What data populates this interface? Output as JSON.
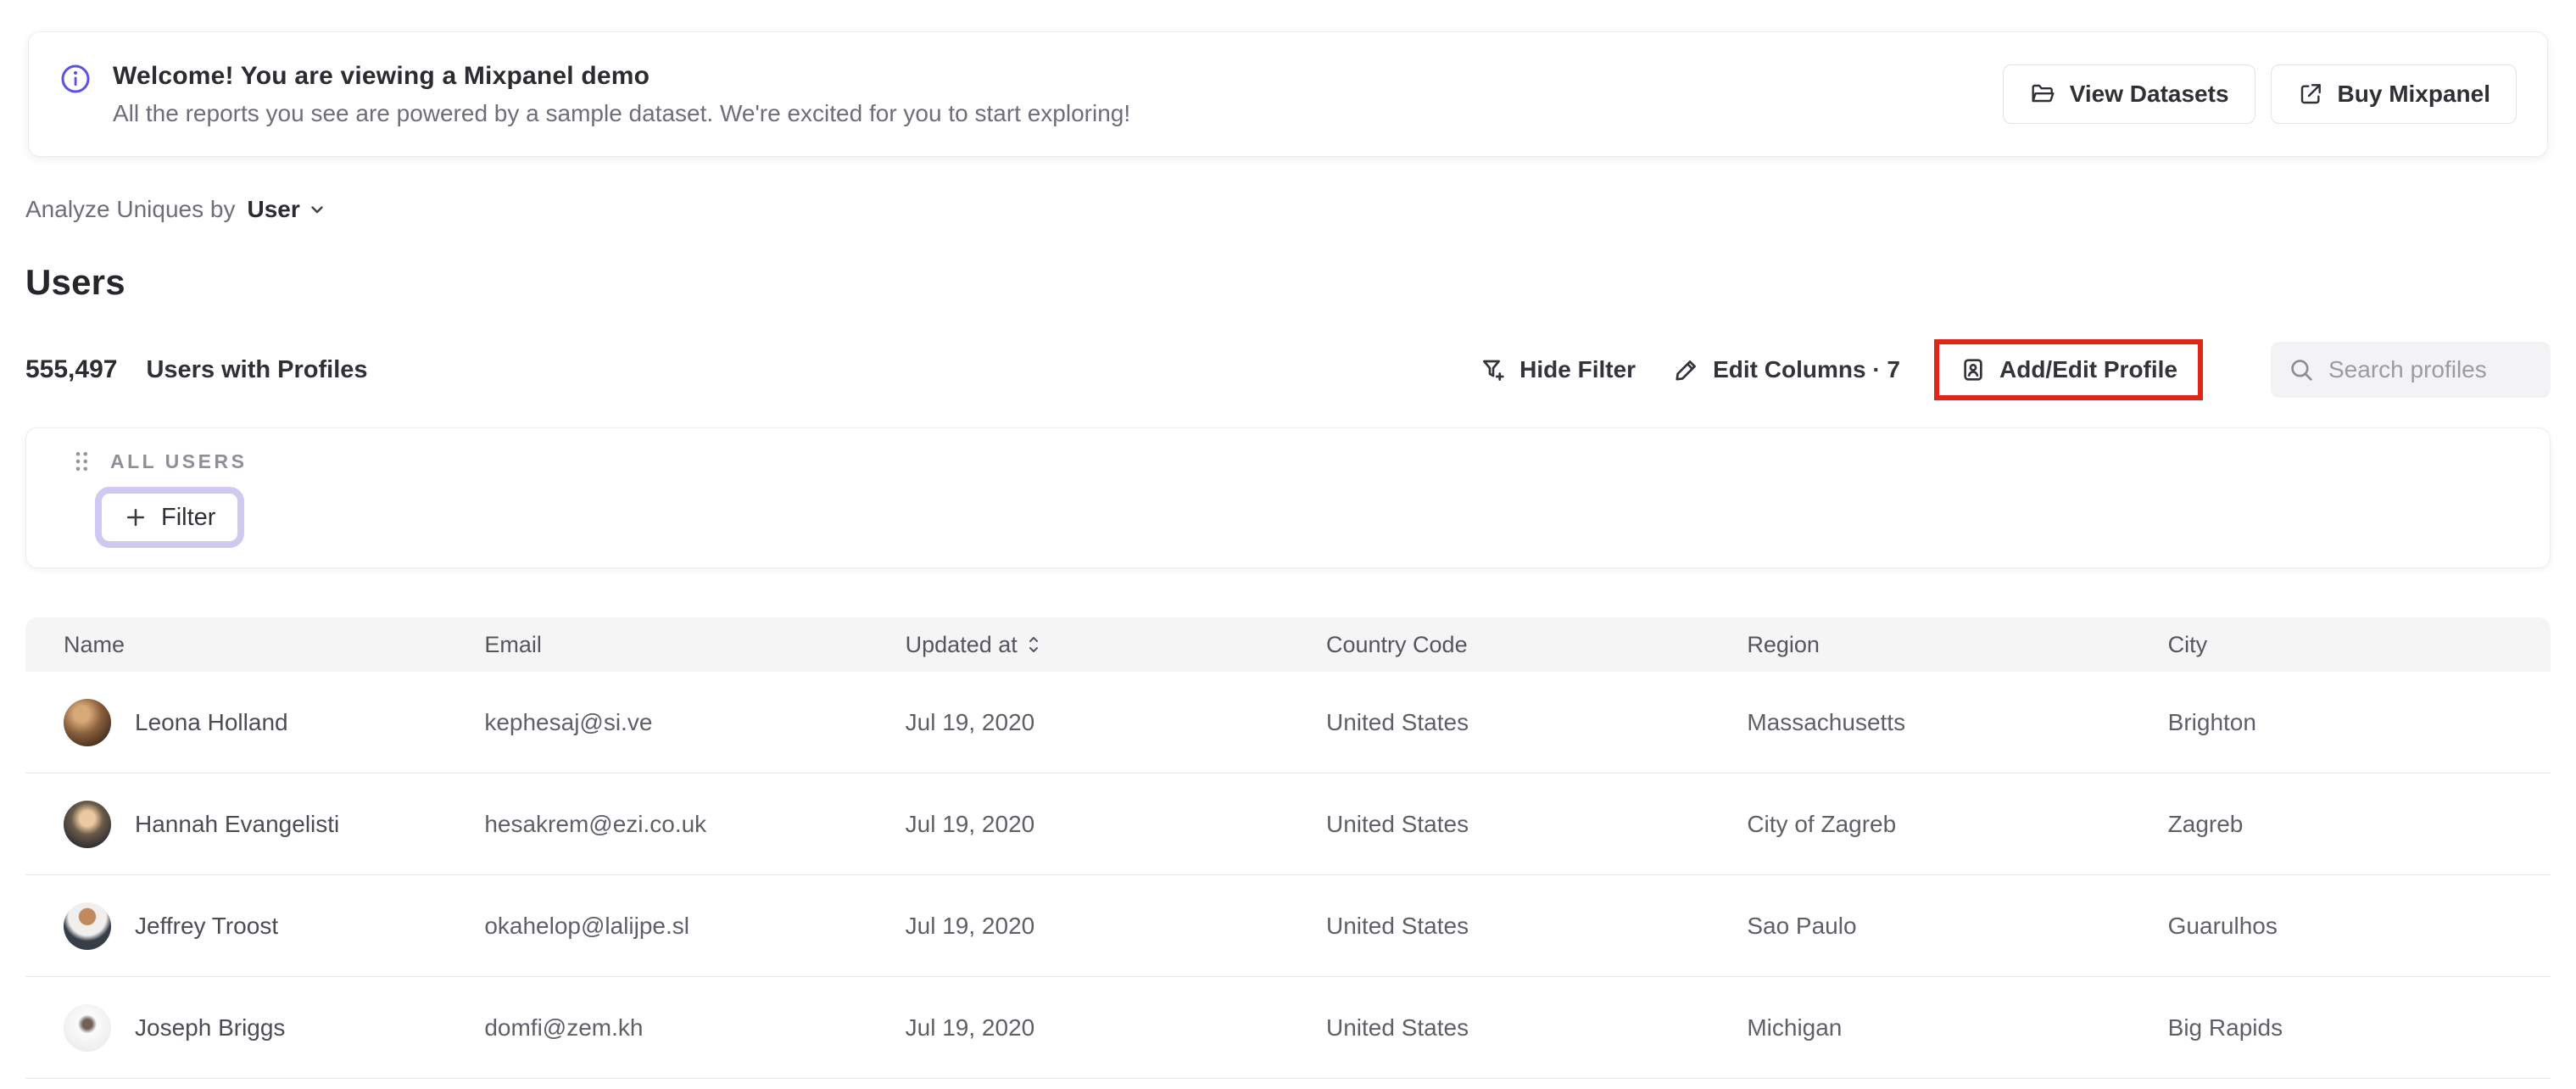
{
  "banner": {
    "title": "Welcome! You are viewing a Mixpanel demo",
    "subtitle": "All the reports you see are powered by a sample dataset. We're excited for you to start exploring!",
    "view_datasets_label": "View Datasets",
    "buy_mixpanel_label": "Buy Mixpanel"
  },
  "breadcrumb": {
    "prefix": "Analyze Uniques by",
    "selected": "User"
  },
  "page": {
    "title": "Users"
  },
  "summary": {
    "count": "555,497",
    "label": "Users with Profiles"
  },
  "toolbar": {
    "hide_filter_label": "Hide Filter",
    "edit_columns_label": "Edit Columns · 7",
    "add_edit_profile_label": "Add/Edit Profile",
    "search_placeholder": "Search profiles"
  },
  "filter_panel": {
    "group_label": "ALL USERS",
    "filter_button_label": "Filter"
  },
  "table": {
    "columns": [
      "Name",
      "Email",
      "Updated at",
      "Country Code",
      "Region",
      "City"
    ],
    "rows": [
      {
        "name": "Leona Holland",
        "email": "kephesaj@si.ve",
        "updated_at": "Jul 19, 2020",
        "country": "United States",
        "region": "Massachusetts",
        "city": "Brighton"
      },
      {
        "name": "Hannah Evangelisti",
        "email": "hesakrem@ezi.co.uk",
        "updated_at": "Jul 19, 2020",
        "country": "United States",
        "region": "City of Zagreb",
        "city": "Zagreb"
      },
      {
        "name": "Jeffrey Troost",
        "email": "okahelop@lalijpe.sl",
        "updated_at": "Jul 19, 2020",
        "country": "United States",
        "region": "Sao Paulo",
        "city": "Guarulhos"
      },
      {
        "name": "Joseph Briggs",
        "email": "domfi@zem.kh",
        "updated_at": "Jul 19, 2020",
        "country": "United States",
        "region": "Michigan",
        "city": "Big Rapids"
      }
    ]
  },
  "colors": {
    "accent_purple": "#5b51e8",
    "highlight_red": "#e1251b",
    "focus_ring_lavender": "#cdc9f3"
  }
}
